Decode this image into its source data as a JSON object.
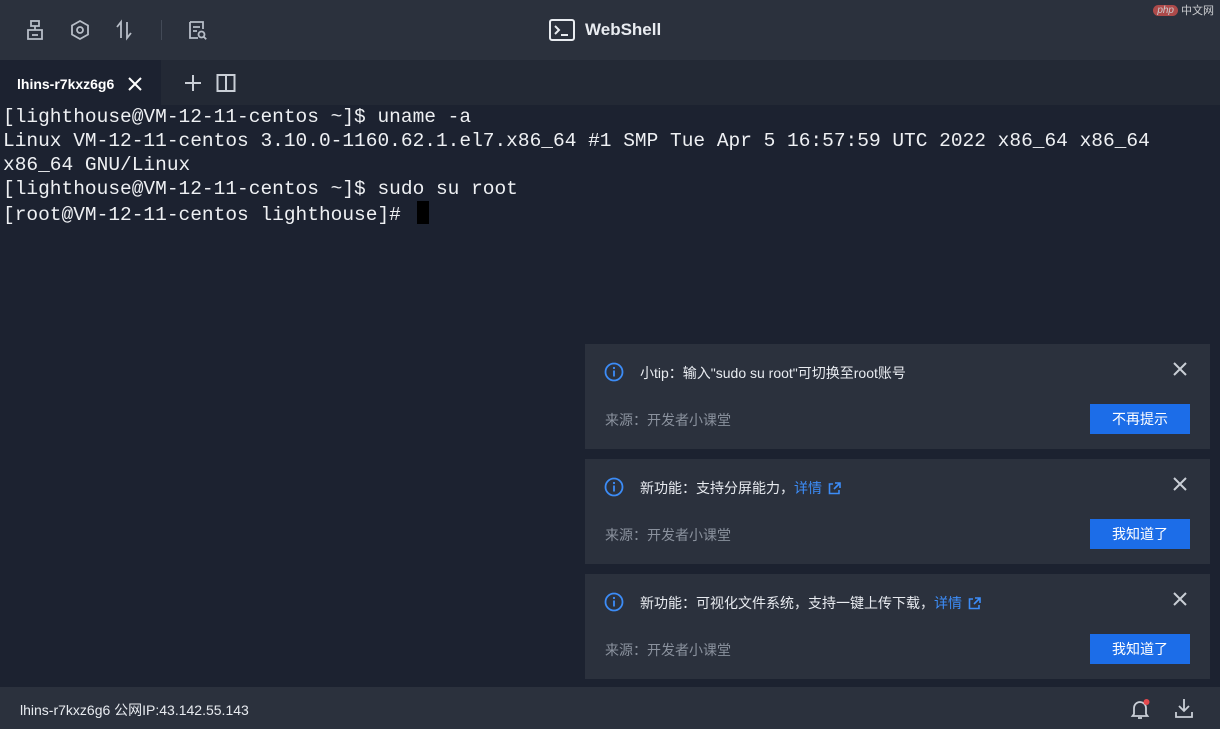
{
  "toolbar": {
    "icons": [
      "hierarchy-icon",
      "settings-hex-icon",
      "transfer-arrows-icon",
      "file-search-icon"
    ]
  },
  "header": {
    "title": "WebShell"
  },
  "watermark": {
    "brand": "php",
    "text": "中文网"
  },
  "tabs": [
    {
      "label": "lhins-r7kxz6g6"
    }
  ],
  "terminal": {
    "lines": [
      "[lighthouse@VM-12-11-centos ~]$ uname -a",
      "Linux VM-12-11-centos 3.10.0-1160.62.1.el7.x86_64 #1 SMP Tue Apr 5 16:57:59 UTC 2022 x86_64 x86_64",
      "x86_64 GNU/Linux",
      "[lighthouse@VM-12-11-centos ~]$ sudo su root",
      "[root@VM-12-11-centos lighthouse]# "
    ]
  },
  "notifications": [
    {
      "title": "小tip：输入\"sudo su root\"可切换至root账号",
      "link": "",
      "source": "来源：开发者小课堂",
      "button": "不再提示"
    },
    {
      "title": "新功能：支持分屏能力，",
      "link": "详情",
      "source": "来源：开发者小课堂",
      "button": "我知道了"
    },
    {
      "title": "新功能：可视化文件系统，支持一键上传下载，",
      "link": "详情",
      "source": "来源：开发者小课堂",
      "button": "我知道了"
    }
  ],
  "status": {
    "text": "lhins-r7kxz6g6 公网IP:43.142.55.143"
  },
  "colors": {
    "accent": "#1c6de8",
    "link": "#3c8cf7",
    "background": "#1c2230",
    "panel": "#2b313d"
  }
}
